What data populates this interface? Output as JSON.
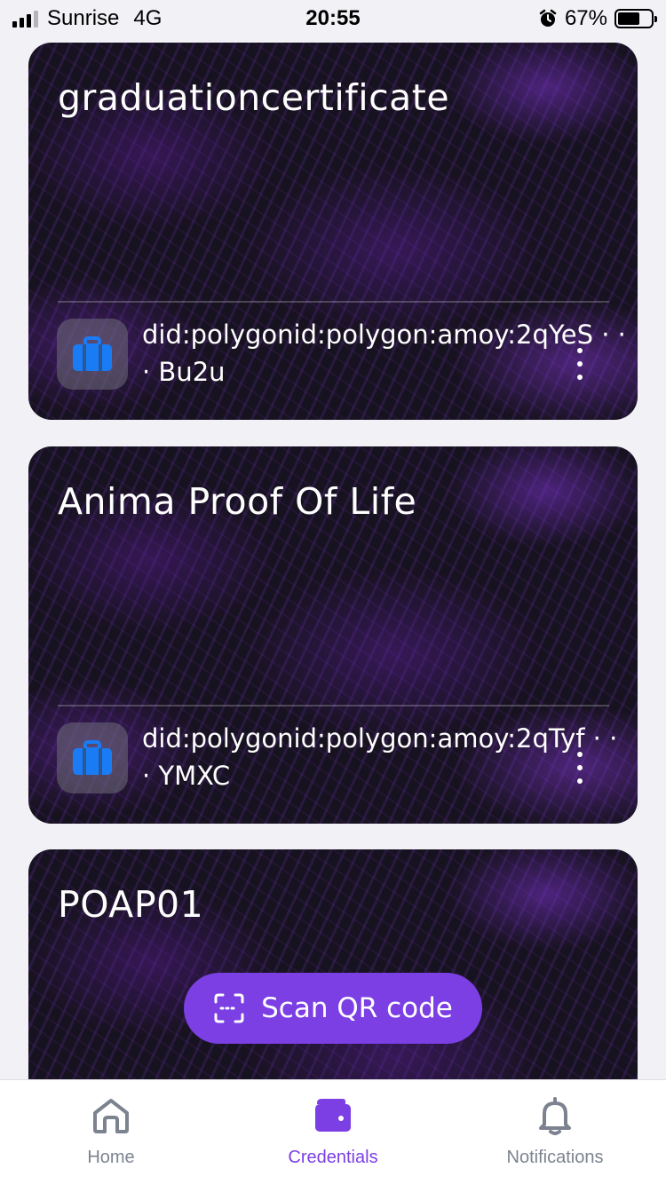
{
  "status_bar": {
    "carrier": "Sunrise",
    "network": "4G",
    "time": "20:55",
    "battery_percent": "67%",
    "battery_level": 0.67
  },
  "cards": [
    {
      "title": "graduationcertificate",
      "did_line1": "did:polygonid:polygon:amoy:2qYeS · ·",
      "did_line2": "· Bu2u",
      "icon": "briefcase-icon"
    },
    {
      "title": "Anima Proof Of Life",
      "did_line1": "did:polygonid:polygon:amoy:2qTyf · ·",
      "did_line2": "· YMXC",
      "icon": "briefcase-icon"
    },
    {
      "title": "POAP01"
    }
  ],
  "scan_button": {
    "label": "Scan QR code",
    "icon": "qr-scan-icon"
  },
  "tab_bar": {
    "home": "Home",
    "credentials": "Credentials",
    "notifications": "Notifications",
    "active": "credentials"
  },
  "colors": {
    "accent": "#7b3fe4",
    "icon_blue": "#1a7cf5",
    "inactive": "#7d8290"
  }
}
